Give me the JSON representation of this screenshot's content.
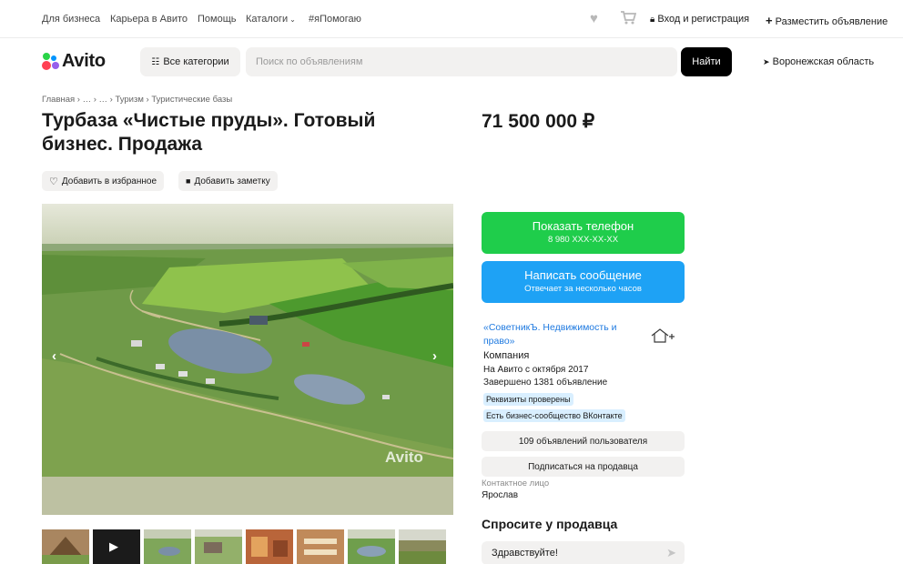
{
  "topbar": {
    "links": [
      "Для бизнеса",
      "Карьера в Авито",
      "Помощь",
      "Каталоги",
      "#яПомогаю"
    ],
    "login_label": "Вход и регистрация",
    "post_ad_label": "Разместить объявление",
    "icons": [
      "heart-icon",
      "cart-icon",
      "lock-icon",
      "plus-icon",
      "chevron-down-icon"
    ]
  },
  "header": {
    "logo_text": "Avito",
    "categories_label": "Все категории",
    "search_placeholder": "Поиск по объявлениям",
    "find_label": "Найти",
    "region": "Воронежская область"
  },
  "breadcrumbs": "Главная › … › … › Туризм › Туристические базы",
  "listing": {
    "title": "Турбаза «Чистые пруды». Готовый бизнес. Продажа",
    "price": "71 500 000 ₽",
    "favorite_label": "Добавить в избранное",
    "note_label": "Добавить заметку",
    "watermark": "Avito"
  },
  "contact": {
    "phone_label": "Показать телефон",
    "phone_number": "8 980 XXX-XX-XX",
    "message_label": "Написать сообщение",
    "message_sub": "Отвечает за несколько часов"
  },
  "seller": {
    "name": "«СоветникЪ. Недвижимость и право»",
    "type": "Компания",
    "since": "На Авито с октября 2017",
    "completed": "Завершено 1381 объявление",
    "badge_verified": "Реквизиты проверены",
    "badge_vk": "Есть бизнес-сообщество ВКонтакте",
    "ads_count_label": "109 объявлений пользователя",
    "subscribe_label": "Подписаться на продавца",
    "contact_person_label": "Контактное лицо",
    "contact_person": "Ярослав"
  },
  "ask": {
    "title": "Спросите у продавца",
    "message": "Здравствуйте!"
  },
  "colors": {
    "phone_button": "#1fcd4b",
    "message_button": "#1ea2f5",
    "link": "#1f7ae0",
    "badge_bg": "#d9efff",
    "logo_green": "#2ad448",
    "logo_blue": "#0095ff",
    "logo_red": "#ff4053",
    "logo_purple": "#965eeb"
  }
}
